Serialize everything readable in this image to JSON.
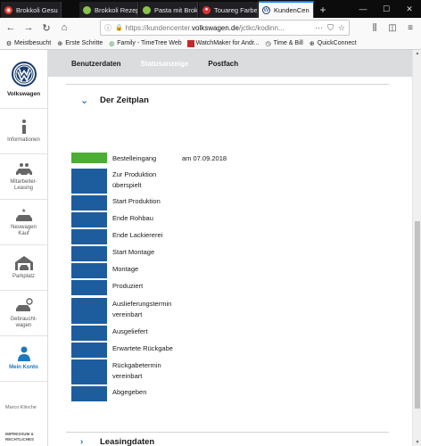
{
  "browser": {
    "tabs": [
      {
        "title": "Brokkoli Gesu",
        "active": false
      },
      {
        "title": "Brokkoli Rezep",
        "active": false
      },
      {
        "title": "Pasta mit Brok",
        "active": false
      },
      {
        "title": "Touareg Farbe",
        "active": false
      },
      {
        "title": "KundenCen",
        "active": true
      }
    ],
    "url_host": "https://kundencenter.",
    "url_domain": "volkswagen.de",
    "url_path": "/jctkc/kodinn...",
    "bookmarks": [
      {
        "label": "Meistbesucht",
        "icon": "gear-icon"
      },
      {
        "label": "Erste Schritte",
        "icon": "globe-icon"
      },
      {
        "label": "Family - TimeTree Web",
        "icon": "timetree-icon"
      },
      {
        "label": "WatchMaker for Andr...",
        "icon": "watchmaker-icon"
      },
      {
        "label": "Time & Bill",
        "icon": "clock-icon"
      },
      {
        "label": "QuickConnect",
        "icon": "globe-icon"
      }
    ]
  },
  "sidebar": {
    "brand": "Volkswagen",
    "items": [
      {
        "label": "Informationen",
        "icon": "info-icon"
      },
      {
        "label": "Mitarbeiter-\nLeasing",
        "icon": "car-people-icon"
      },
      {
        "label": "Neuwagen\nKauf",
        "icon": "new-car-icon"
      },
      {
        "label": "Parkplatz",
        "icon": "garage-icon"
      },
      {
        "label": "Gebraucht-\nwagen",
        "icon": "used-car-icon"
      },
      {
        "label": "Mein Konto",
        "icon": "person-icon"
      }
    ],
    "user": "Marco Klinche",
    "legal": "IMPRESSUM &\nRECHTLICHES"
  },
  "subnav": {
    "tabs": [
      "Benutzerdaten",
      "Statusanzeige",
      "Postfach"
    ],
    "active": "Statusanzeige"
  },
  "zeitplan": {
    "title": "Der Zeitplan",
    "steps": [
      {
        "label": "Bestelleingang",
        "date": "am 07.09.2018",
        "done": true
      },
      {
        "label": "Zur Produktion überspielt",
        "date": "",
        "done": false
      },
      {
        "label": "Start Produktion",
        "date": "",
        "done": false
      },
      {
        "label": "Ende Rohbau",
        "date": "",
        "done": false
      },
      {
        "label": "Ende Lackiererei",
        "date": "",
        "done": false
      },
      {
        "label": "Start Montage",
        "date": "",
        "done": false
      },
      {
        "label": "Montage",
        "date": "",
        "done": false
      },
      {
        "label": "Produziert",
        "date": "",
        "done": false
      },
      {
        "label": "Auslieferungstermin vereinbart",
        "date": "",
        "done": false
      },
      {
        "label": "Ausgeliefert",
        "date": "",
        "done": false
      },
      {
        "label": "Erwartete Rückgabe",
        "date": "",
        "done": false
      },
      {
        "label": "Rückgabetermin vereinbart",
        "date": "",
        "done": false
      },
      {
        "label": "Abgegeben",
        "date": "",
        "done": false
      }
    ]
  },
  "leasingdaten": {
    "title": "Leasingdaten"
  },
  "colors": {
    "vw_blue": "#1d5d9e",
    "done_green": "#4cae34",
    "accent": "#1d78bf"
  }
}
